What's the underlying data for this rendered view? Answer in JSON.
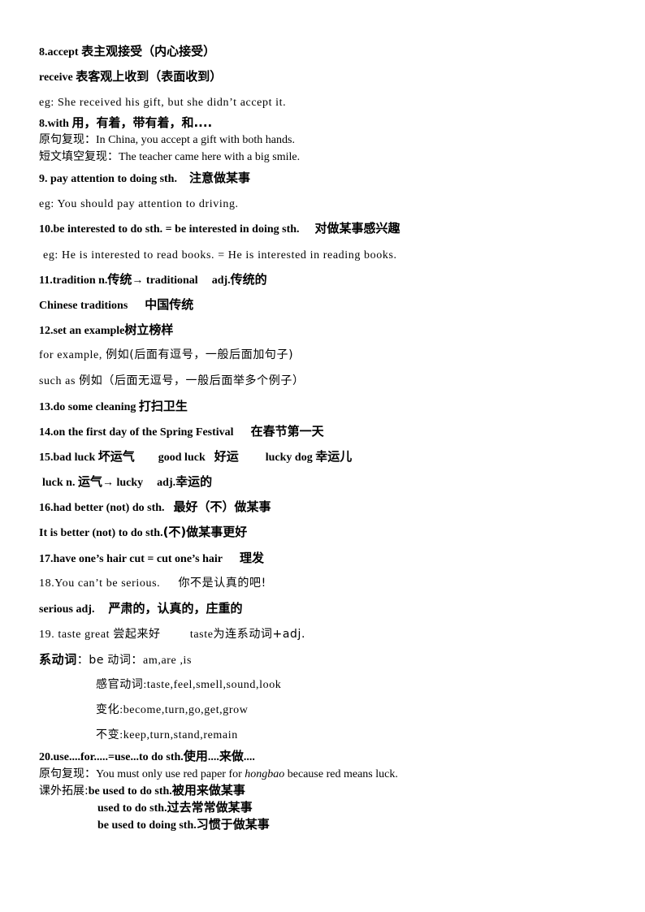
{
  "items": {
    "l01": {
      "a": "8.accept",
      "b": "表主观接受（内心接受）"
    },
    "l02": {
      "a": "receive",
      "b": "表客观上收到（表面收到）"
    },
    "l03": {
      "a": "eg: She received his gift, but she didn’t accept it."
    },
    "l04": {
      "a": "8.with",
      "b": "用，有着，带有着，和...."
    },
    "l05": {
      "a": "原句复现：",
      "b": "In China, you accept a gift with both hands."
    },
    "l06": {
      "a": "短文填空复现：",
      "b": "The teacher came here with a big smile."
    },
    "l07": {
      "a": "9.  pay attention to doing sth.",
      "b": "注意做某事"
    },
    "l08": {
      "a": "eg: You should pay attention to driving."
    },
    "l09": {
      "a": "10.be interested to do sth.  = be interested in doing sth.",
      "b": "对做某事感兴趣"
    },
    "l10": {
      "a": "eg: He is interested to read books. = He is interested in reading books."
    },
    "l11": {
      "a": "11.tradition  n.",
      "b": "传统",
      "c": "→ traditional",
      "d": "adj.",
      "e": "传统的"
    },
    "l12": {
      "a": "Chinese traditions",
      "b": "中国传统"
    },
    "l13": {
      "a": "12.set an example",
      "b": "树立榜样"
    },
    "l14": {
      "a": "for example,",
      "b": "例如(后面有逗号，一般后面加句子)"
    },
    "l15": {
      "a": "such as",
      "b": "例如（后面无逗号，一般后面举多个例子）"
    },
    "l16": {
      "a": "13.do some cleaning",
      "b": "打扫卫生"
    },
    "l17": {
      "a": "14.on the first day of the Spring Festival",
      "b": "在春节第一天"
    },
    "l18": {
      "a": "15.bad luck",
      "b": "坏运气",
      "c": "good luck",
      "d": "好运",
      "e": "lucky dog",
      "f": "幸运儿"
    },
    "l19": {
      "a": "luck n.",
      "b": "运气",
      "c": "→ lucky",
      "d": "adj.",
      "e": "幸运的"
    },
    "l20": {
      "a": "16.had better (not) do sth.",
      "b": "最好（不）做某事"
    },
    "l21": {
      "a": "It is better (not) to do sth.",
      "b": "(不)做某事更好"
    },
    "l22": {
      "a": "17.have one’s hair cut = cut one’s hair",
      "b": "理发"
    },
    "l23": {
      "a": "18.You can’t be serious.",
      "b": "你不是认真的吧!"
    },
    "l24": {
      "a": "serious adj.",
      "b": "严肃的，认真的，庄重的"
    },
    "l25": {
      "a": "19. taste great",
      "b": "尝起来好",
      "c": "taste",
      "d": "为连系动词+adj."
    },
    "l26": {
      "a": "系动词",
      "b": "：be",
      "c": "动词：",
      "d": "am,are ,is"
    },
    "l27": {
      "a": "感官动词",
      "b": ":taste,feel,smell,sound,look"
    },
    "l28": {
      "a": "变化",
      "b": ":become,turn,go,get,grow"
    },
    "l29": {
      "a": "不变",
      "b": ":keep,turn,stand,remain"
    },
    "l30": {
      "a": "20.use....for.....=use...to do sth.",
      "b": "使用",
      "c": "....",
      "d": "来做",
      "e": "...."
    },
    "l31": {
      "a": "原句复现：",
      "b": "You must only use red paper for ",
      "c": "hongbao",
      "d": " because red means luck."
    },
    "l32": {
      "a": "课外拓展:",
      "b": "be used to do sth.",
      "c": "被用来做某事"
    },
    "l33": {
      "a": "used to do sth.",
      "b": "过去常常做某事"
    },
    "l34": {
      "a": "be used to doing sth.",
      "b": "习惯于做某事"
    }
  }
}
